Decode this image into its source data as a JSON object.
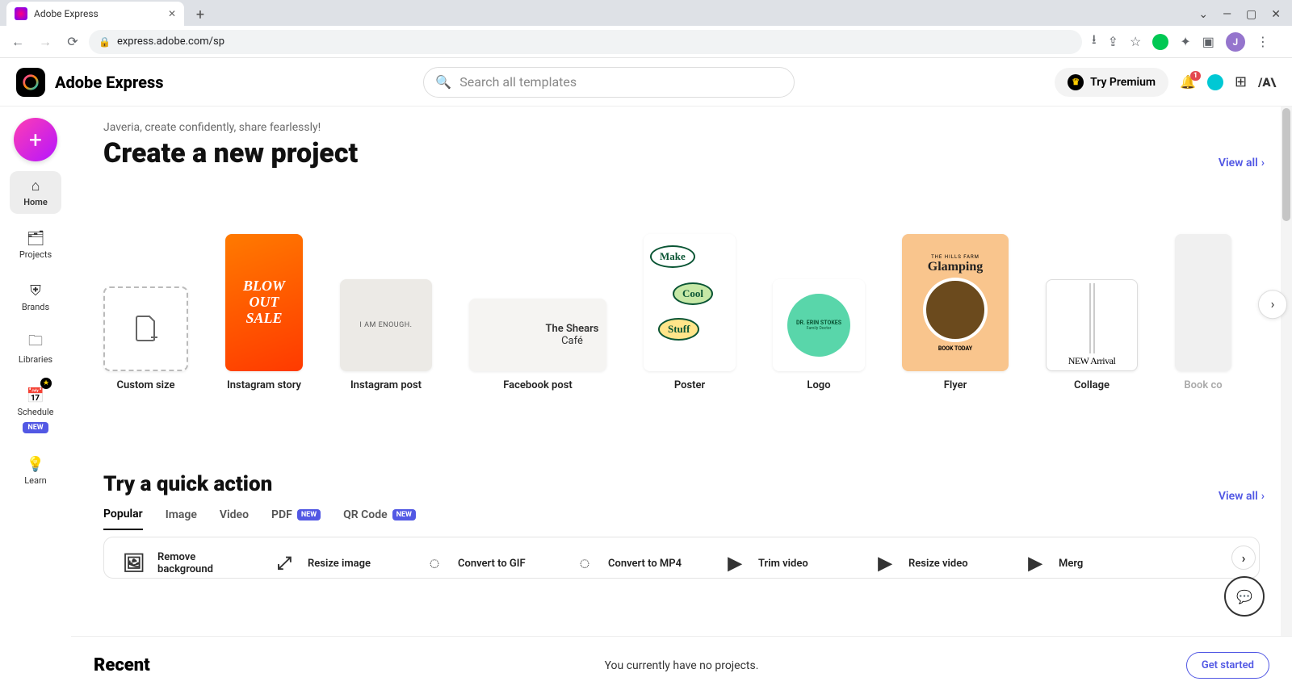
{
  "browser": {
    "tab_title": "Adobe Express",
    "url": "express.adobe.com/sp",
    "avatar_letter": "J"
  },
  "header": {
    "brand": "Adobe Express",
    "search_placeholder": "Search all templates",
    "try_premium": "Try Premium",
    "notification_count": "1"
  },
  "sidebar": {
    "items": [
      {
        "label": "Home"
      },
      {
        "label": "Projects"
      },
      {
        "label": "Brands"
      },
      {
        "label": "Libraries"
      },
      {
        "label": "Schedule"
      },
      {
        "label": "Learn"
      }
    ],
    "new_badge": "NEW"
  },
  "greeting": "Javeria, create confidently, share fearlessly!",
  "create_title": "Create a new project",
  "view_all": "View all",
  "templates": [
    {
      "label": "Custom size"
    },
    {
      "label": "Instagram story",
      "sale": "BLOW OUT SALE"
    },
    {
      "label": "Instagram post",
      "text": "I AM ENOUGH."
    },
    {
      "label": "Facebook post",
      "text_a": "The Shears",
      "text_b": "Café"
    },
    {
      "label": "Poster",
      "b1": "Make",
      "b2": "Cool",
      "b3": "Stuff"
    },
    {
      "label": "Logo",
      "name": "DR. ERIN STOKES",
      "sub": "Family Doctor"
    },
    {
      "label": "Flyer",
      "pre": "THE HILLS FARM",
      "title": "Glamping",
      "cta": "BOOK TODAY"
    },
    {
      "label": "Collage",
      "txt": "NEW Arrival"
    },
    {
      "label": "Book co"
    }
  ],
  "quick_title": "Try a quick action",
  "quick_tabs": [
    {
      "label": "Popular"
    },
    {
      "label": "Image"
    },
    {
      "label": "Video"
    },
    {
      "label": "PDF",
      "badge": "NEW"
    },
    {
      "label": "QR Code",
      "badge": "NEW"
    }
  ],
  "actions": [
    {
      "label": "Remove\nbackground"
    },
    {
      "label": "Resize image"
    },
    {
      "label": "Convert to GIF"
    },
    {
      "label": "Convert to MP4"
    },
    {
      "label": "Trim video"
    },
    {
      "label": "Resize video"
    },
    {
      "label": "Merg"
    }
  ],
  "footer": {
    "title": "Recent",
    "empty_msg": "You currently have no projects.",
    "cta": "Get started"
  }
}
